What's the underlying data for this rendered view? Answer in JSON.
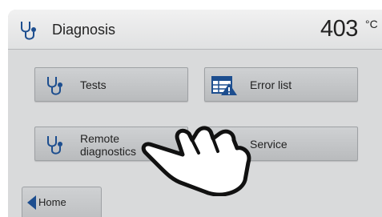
{
  "header": {
    "title": "Diagnosis",
    "temperature": "403",
    "unit": "°C",
    "icon": "stethoscope-icon"
  },
  "buttons": {
    "tests": {
      "label": "Tests",
      "icon": "stethoscope-icon"
    },
    "error_list": {
      "label": "Error list",
      "icon": "error-list-icon"
    },
    "remote": {
      "label_line1": "Remote",
      "label_line2": "diagnostics",
      "icon": "stethoscope-icon"
    },
    "service": {
      "label": "Service",
      "icon": "stethoscope-icon"
    }
  },
  "home": {
    "label": "Home",
    "icon": "back-arrow-icon"
  },
  "colors": {
    "background": "#d9dadb",
    "button": "#c4c6c8",
    "icon_blue": "#1d4e8f",
    "warning": "#1d4e8f"
  }
}
